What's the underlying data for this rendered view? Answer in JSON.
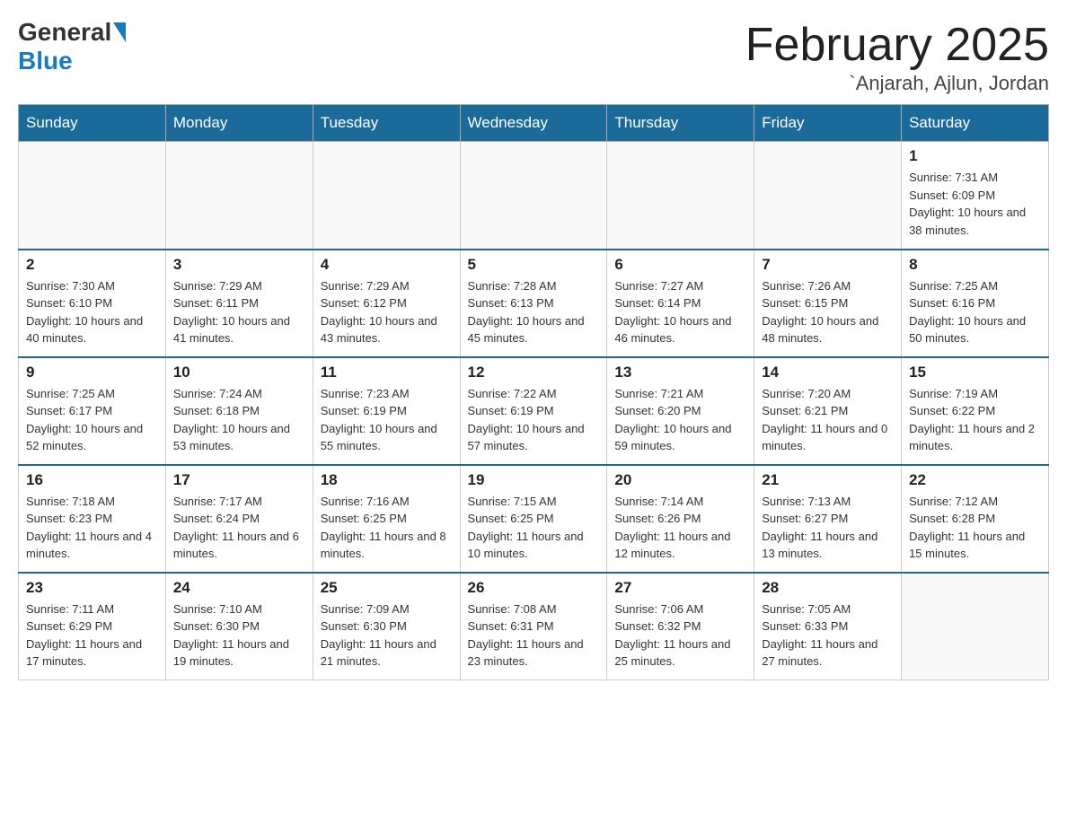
{
  "header": {
    "logo_general": "General",
    "logo_blue": "Blue",
    "month_title": "February 2025",
    "location": "`Anjarah, Ajlun, Jordan"
  },
  "days_of_week": [
    "Sunday",
    "Monday",
    "Tuesday",
    "Wednesday",
    "Thursday",
    "Friday",
    "Saturday"
  ],
  "weeks": [
    [
      {
        "day": "",
        "info": ""
      },
      {
        "day": "",
        "info": ""
      },
      {
        "day": "",
        "info": ""
      },
      {
        "day": "",
        "info": ""
      },
      {
        "day": "",
        "info": ""
      },
      {
        "day": "",
        "info": ""
      },
      {
        "day": "1",
        "info": "Sunrise: 7:31 AM\nSunset: 6:09 PM\nDaylight: 10 hours and 38 minutes."
      }
    ],
    [
      {
        "day": "2",
        "info": "Sunrise: 7:30 AM\nSunset: 6:10 PM\nDaylight: 10 hours and 40 minutes."
      },
      {
        "day": "3",
        "info": "Sunrise: 7:29 AM\nSunset: 6:11 PM\nDaylight: 10 hours and 41 minutes."
      },
      {
        "day": "4",
        "info": "Sunrise: 7:29 AM\nSunset: 6:12 PM\nDaylight: 10 hours and 43 minutes."
      },
      {
        "day": "5",
        "info": "Sunrise: 7:28 AM\nSunset: 6:13 PM\nDaylight: 10 hours and 45 minutes."
      },
      {
        "day": "6",
        "info": "Sunrise: 7:27 AM\nSunset: 6:14 PM\nDaylight: 10 hours and 46 minutes."
      },
      {
        "day": "7",
        "info": "Sunrise: 7:26 AM\nSunset: 6:15 PM\nDaylight: 10 hours and 48 minutes."
      },
      {
        "day": "8",
        "info": "Sunrise: 7:25 AM\nSunset: 6:16 PM\nDaylight: 10 hours and 50 minutes."
      }
    ],
    [
      {
        "day": "9",
        "info": "Sunrise: 7:25 AM\nSunset: 6:17 PM\nDaylight: 10 hours and 52 minutes."
      },
      {
        "day": "10",
        "info": "Sunrise: 7:24 AM\nSunset: 6:18 PM\nDaylight: 10 hours and 53 minutes."
      },
      {
        "day": "11",
        "info": "Sunrise: 7:23 AM\nSunset: 6:19 PM\nDaylight: 10 hours and 55 minutes."
      },
      {
        "day": "12",
        "info": "Sunrise: 7:22 AM\nSunset: 6:19 PM\nDaylight: 10 hours and 57 minutes."
      },
      {
        "day": "13",
        "info": "Sunrise: 7:21 AM\nSunset: 6:20 PM\nDaylight: 10 hours and 59 minutes."
      },
      {
        "day": "14",
        "info": "Sunrise: 7:20 AM\nSunset: 6:21 PM\nDaylight: 11 hours and 0 minutes."
      },
      {
        "day": "15",
        "info": "Sunrise: 7:19 AM\nSunset: 6:22 PM\nDaylight: 11 hours and 2 minutes."
      }
    ],
    [
      {
        "day": "16",
        "info": "Sunrise: 7:18 AM\nSunset: 6:23 PM\nDaylight: 11 hours and 4 minutes."
      },
      {
        "day": "17",
        "info": "Sunrise: 7:17 AM\nSunset: 6:24 PM\nDaylight: 11 hours and 6 minutes."
      },
      {
        "day": "18",
        "info": "Sunrise: 7:16 AM\nSunset: 6:25 PM\nDaylight: 11 hours and 8 minutes."
      },
      {
        "day": "19",
        "info": "Sunrise: 7:15 AM\nSunset: 6:25 PM\nDaylight: 11 hours and 10 minutes."
      },
      {
        "day": "20",
        "info": "Sunrise: 7:14 AM\nSunset: 6:26 PM\nDaylight: 11 hours and 12 minutes."
      },
      {
        "day": "21",
        "info": "Sunrise: 7:13 AM\nSunset: 6:27 PM\nDaylight: 11 hours and 13 minutes."
      },
      {
        "day": "22",
        "info": "Sunrise: 7:12 AM\nSunset: 6:28 PM\nDaylight: 11 hours and 15 minutes."
      }
    ],
    [
      {
        "day": "23",
        "info": "Sunrise: 7:11 AM\nSunset: 6:29 PM\nDaylight: 11 hours and 17 minutes."
      },
      {
        "day": "24",
        "info": "Sunrise: 7:10 AM\nSunset: 6:30 PM\nDaylight: 11 hours and 19 minutes."
      },
      {
        "day": "25",
        "info": "Sunrise: 7:09 AM\nSunset: 6:30 PM\nDaylight: 11 hours and 21 minutes."
      },
      {
        "day": "26",
        "info": "Sunrise: 7:08 AM\nSunset: 6:31 PM\nDaylight: 11 hours and 23 minutes."
      },
      {
        "day": "27",
        "info": "Sunrise: 7:06 AM\nSunset: 6:32 PM\nDaylight: 11 hours and 25 minutes."
      },
      {
        "day": "28",
        "info": "Sunrise: 7:05 AM\nSunset: 6:33 PM\nDaylight: 11 hours and 27 minutes."
      },
      {
        "day": "",
        "info": ""
      }
    ]
  ]
}
